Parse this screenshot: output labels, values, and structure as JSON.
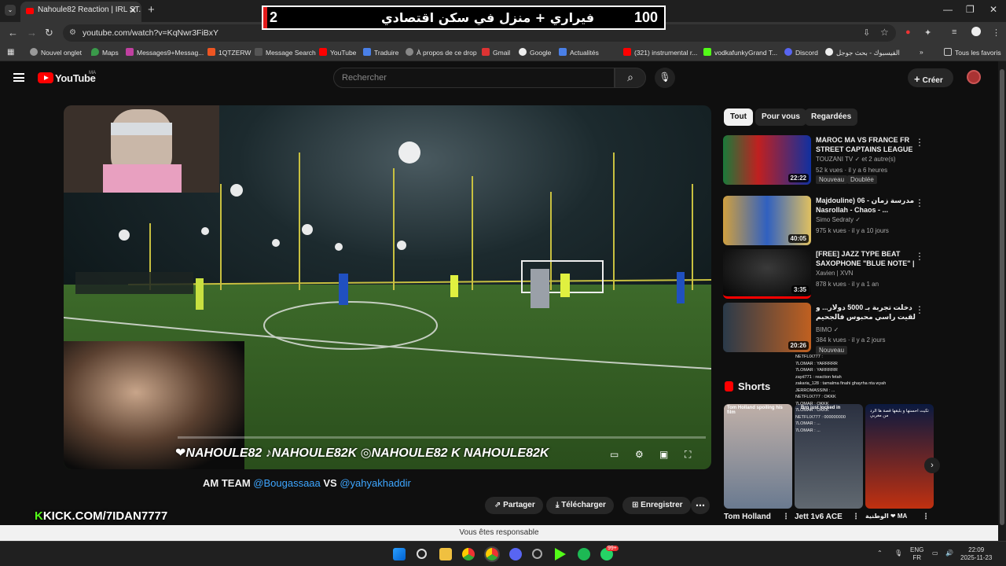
{
  "browser": {
    "tab_title": "Nahoule82 Reaction | IRL ST...",
    "url": "youtube.com/watch?v=KqNwr3FiBxY",
    "bookmarks": [
      "Nouvel onglet",
      "Maps",
      "Messages9+Messag...",
      "1QTZERW",
      "Message Search",
      "YouTube",
      "Traduire",
      "À propos de ce drop",
      "Gmail",
      "Google",
      "Actualités",
      "(321) instrumental r...",
      "vodkafunkyGrand T...",
      "Discord",
      "الفيسبوك - بحث جوجل",
      "Tous les favoris"
    ]
  },
  "stream_overlay": {
    "left_number": "2",
    "title": "فيراري + منزل في سكن اقتصادي",
    "right_number": "100"
  },
  "youtube": {
    "logo_text": "YouTube",
    "country_code": "MA",
    "search_placeholder": "Rechercher",
    "create_label": "Créer",
    "player_tags": "❤NAHOULE82  ♪NAHOULE82K  ◎NAHOULE82  K NAHOULE82K",
    "kick_prefix": "K",
    "kick_text": "KICK.COM/7IDAN7777",
    "video_title_prefix": "AM TEAM ",
    "video_title_m1": "@Bougassaaa",
    "video_title_vs": " VS ",
    "video_title_m2": "@yahyakhaddir",
    "actions": {
      "share": "Partager",
      "download": "Télécharger",
      "save": "Enregistrer"
    },
    "chips": [
      "Tout",
      "Pour vous",
      "Regardées"
    ],
    "recommendations": [
      {
        "title": "MAROC MA VS FRANCE FR STREET CAPTAINS LEAGUE",
        "channel": "TOUZANI TV ✓ et 2 autre(s)",
        "meta": "52 k vues · il y a 6 heures",
        "duration": "22:22",
        "badges": [
          "Nouveau",
          "Doublée"
        ]
      },
      {
        "title": "Majdouline) 06 - مدرسة زمان Nasrollah - Chaos - ...",
        "channel": "Simo Sedraty ✓",
        "meta": "975 k vues · il y a 10 jours",
        "duration": "40:05",
        "badges": []
      },
      {
        "title": "[FREE] JAZZ TYPE BEAT SAXOPHONE \"BLUE NOTE\" | ...",
        "channel": "Xavien | XVN",
        "meta": "878 k vues · il y a 1 an",
        "duration": "3:35",
        "badges": []
      },
      {
        "title": "دخلت تجربة بـ 5000 دولار... و لقيت راسي محبوس فالجحيم",
        "channel": "BIMO ✓",
        "meta": "384 k vues · il y a 2 jours",
        "duration": "20:26",
        "badges": [
          "Nouveau"
        ]
      }
    ],
    "shorts_label": "Shorts",
    "shorts": [
      {
        "title": "Tom Holland",
        "caption": "Tom Holland spoiling his film"
      },
      {
        "title": "Jett 1v6 ACE",
        "caption": "Bro just locked in"
      },
      {
        "title": "الوطنية ❤ MA",
        "caption": "تكيت احسنها و بلبقها قصة ها الرد من مغربي"
      }
    ],
    "chat_lines": [
      "NETFLIX777 : ",
      "7LOMAR : YARRRRR",
      "7LOMAR : YARRRRR",
      "zayd771 : reaction fetah",
      "zakaria_128 : tamalma finahi ghayrha nta wyah",
      "JERROMASSINI : ...",
      "NETFLIX777 : OKKK",
      "7LOMAR : OKKK",
      "7LOMAR : OKKK",
      "NETFLIX777 : 000000000",
      "7LOMAR : ...",
      "7LOMAR : ..."
    ]
  },
  "notification": "Vous êtes responsable",
  "taskbar": {
    "lang": "ENG",
    "lang2": "FR",
    "time": "22:09",
    "date": "2025-11-23",
    "badge": "99+"
  }
}
